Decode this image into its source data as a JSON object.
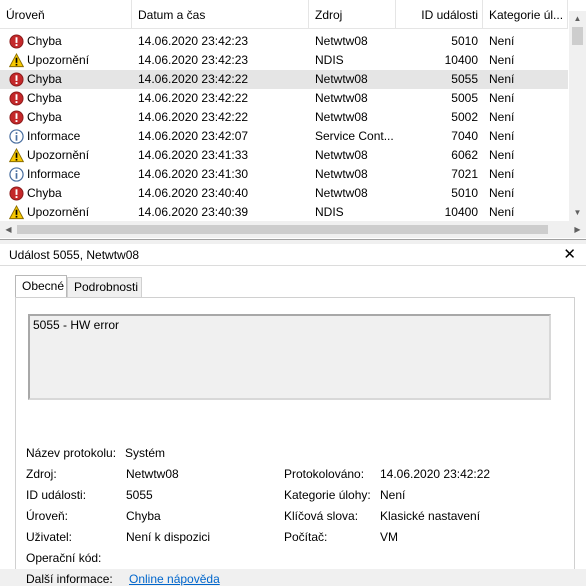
{
  "list": {
    "columns": [
      "Úroveň",
      "Datum a čas",
      "Zdroj",
      "ID události",
      "Kategorie úl..."
    ],
    "rows": [
      {
        "level": "Chyba",
        "icon": "error-icon",
        "date": "14.06.2020 23:42:23",
        "source": "Netwtw08",
        "id": "5010",
        "category": "Není"
      },
      {
        "level": "Upozornění",
        "icon": "warning-icon",
        "date": "14.06.2020 23:42:23",
        "source": "NDIS",
        "id": "10400",
        "category": "Není"
      },
      {
        "level": "Chyba",
        "icon": "error-icon",
        "date": "14.06.2020 23:42:22",
        "source": "Netwtw08",
        "id": "5055",
        "category": "Není"
      },
      {
        "level": "Chyba",
        "icon": "error-icon",
        "date": "14.06.2020 23:42:22",
        "source": "Netwtw08",
        "id": "5005",
        "category": "Není"
      },
      {
        "level": "Chyba",
        "icon": "error-icon",
        "date": "14.06.2020 23:42:22",
        "source": "Netwtw08",
        "id": "5002",
        "category": "Není"
      },
      {
        "level": "Informace",
        "icon": "info-icon",
        "date": "14.06.2020 23:42:07",
        "source": "Service Cont...",
        "id": "7040",
        "category": "Není"
      },
      {
        "level": "Upozornění",
        "icon": "warning-icon",
        "date": "14.06.2020 23:41:33",
        "source": "Netwtw08",
        "id": "6062",
        "category": "Není"
      },
      {
        "level": "Informace",
        "icon": "info-icon",
        "date": "14.06.2020 23:41:30",
        "source": "Netwtw08",
        "id": "7021",
        "category": "Není"
      },
      {
        "level": "Chyba",
        "icon": "error-icon",
        "date": "14.06.2020 23:40:40",
        "source": "Netwtw08",
        "id": "5010",
        "category": "Není"
      },
      {
        "level": "Upozornění",
        "icon": "warning-icon",
        "date": "14.06.2020 23:40:39",
        "source": "NDIS",
        "id": "10400",
        "category": "Není"
      }
    ],
    "selected_index": 2
  },
  "detail": {
    "title": "Událost 5055, Netwtw08",
    "close_label": "✕",
    "tabs": [
      "Obecné",
      "Podrobnosti"
    ],
    "description": "5055 - HW error",
    "fields": {
      "log_name_label": "Název protokolu:",
      "log_name": "Systém",
      "source_label": "Zdroj:",
      "source": "Netwtw08",
      "logged_label": "Protokolováno:",
      "logged": "14.06.2020 23:42:22",
      "event_id_label": "ID události:",
      "event_id": "5055",
      "task_category_label": "Kategorie úlohy:",
      "task_category": "Není",
      "level_label": "Úroveň:",
      "level": "Chyba",
      "keywords_label": "Klíčová slova:",
      "keywords": "Klasické nastavení",
      "user_label": "Uživatel:",
      "user": "Není k dispozici",
      "computer_label": "Počítač:",
      "computer": "VM",
      "opcode_label": "Operační kód:",
      "more_info_label": "Další informace:",
      "more_info_link": "Online nápověda"
    }
  },
  "colors": {
    "error": "#c4282a",
    "warning": "#f7c800",
    "info": "#4a6fa0",
    "selected_row": "#e5e5e5",
    "link": "#0066cc"
  }
}
